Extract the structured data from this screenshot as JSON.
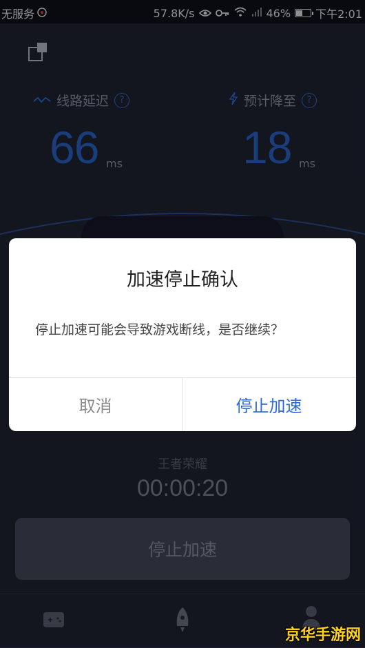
{
  "status_bar": {
    "carrier": "无服务",
    "speed": "57.8K/s",
    "battery": "46%",
    "battery_level": 0.46,
    "time": "下午2:01"
  },
  "metrics": {
    "latency_label": "线路延迟",
    "latency_value": "66",
    "latency_unit": "ms",
    "expected_label": "预计降至",
    "expected_value": "18",
    "expected_unit": "ms"
  },
  "session": {
    "game_name": "王者荣耀",
    "timer": "00:00:20",
    "stop_button_label": "停止加速"
  },
  "dialog": {
    "title": "加速停止确认",
    "message": "停止加速可能会导致游戏断线，是否继续？",
    "cancel_label": "取消",
    "confirm_label": "停止加速"
  },
  "watermark": "京华手游网"
}
